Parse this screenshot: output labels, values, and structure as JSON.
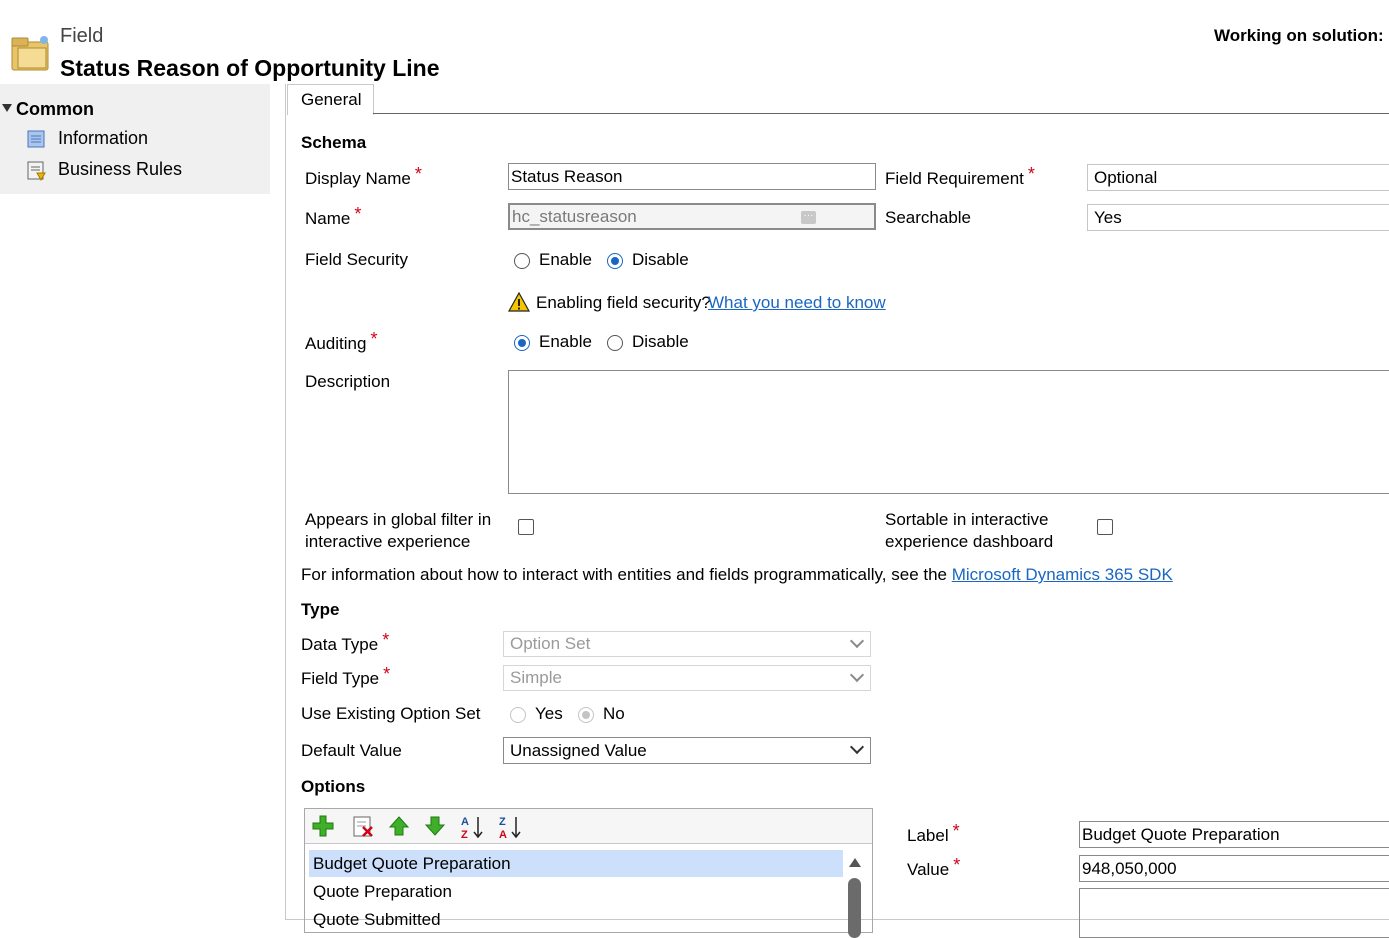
{
  "header": {
    "entity_label": "Field",
    "title": "Status Reason of Opportunity Line",
    "solution_label": "Working on solution: D"
  },
  "sidebar": {
    "group_label": "Common",
    "items": [
      {
        "label": "Information",
        "icon": "information-icon"
      },
      {
        "label": "Business Rules",
        "icon": "business-rules-icon"
      }
    ]
  },
  "tabs": [
    {
      "label": "General"
    }
  ],
  "schema": {
    "section_label": "Schema",
    "display_name": {
      "label": "Display Name",
      "value": "Status Reason"
    },
    "name": {
      "label": "Name",
      "value": "hc_statusreason"
    },
    "field_requirement": {
      "label": "Field Requirement",
      "value": "Optional"
    },
    "searchable": {
      "label": "Searchable",
      "value": "Yes"
    },
    "field_security": {
      "label": "Field Security",
      "enable_label": "Enable",
      "disable_label": "Disable",
      "selected": "Disable"
    },
    "security_warning": {
      "text": "Enabling field security?",
      "link": "What you need to know"
    },
    "auditing": {
      "label": "Auditing",
      "enable_label": "Enable",
      "disable_label": "Disable",
      "selected": "Enable"
    },
    "description": {
      "label": "Description",
      "value": ""
    },
    "global_filter": {
      "label_line1": "Appears in global filter in",
      "label_line2": "interactive experience",
      "checked": false
    },
    "sortable": {
      "label_line1": "Sortable in interactive",
      "label_line2": "experience dashboard",
      "checked": false
    },
    "sdk_note": {
      "text": "For information about how to interact with entities and fields programmatically, see the",
      "link": "Microsoft Dynamics 365 SDK"
    }
  },
  "type": {
    "section_label": "Type",
    "data_type": {
      "label": "Data Type",
      "value": "Option Set"
    },
    "field_type": {
      "label": "Field Type",
      "value": "Simple"
    },
    "use_existing": {
      "label": "Use Existing Option Set",
      "yes_label": "Yes",
      "no_label": "No",
      "selected": "No"
    },
    "default_value": {
      "label": "Default Value",
      "value": "Unassigned Value"
    }
  },
  "options": {
    "section_label": "Options",
    "toolbar": [
      "add-icon",
      "delete-icon",
      "move-up-icon",
      "move-down-icon",
      "sort-ascending-icon",
      "sort-descending-icon"
    ],
    "items": [
      "Budget Quote Preparation",
      "Quote Preparation",
      "Quote Submitted"
    ],
    "selected_index": 0,
    "label": {
      "label": "Label",
      "value": "Budget Quote Preparation"
    },
    "value": {
      "label": "Value",
      "value": "948,050,000"
    }
  },
  "colors": {
    "accent": "#1a66c2",
    "required": "#d0021b",
    "selected_row": "#cce0fb",
    "sidebar_bg": "#f0f0f0"
  }
}
